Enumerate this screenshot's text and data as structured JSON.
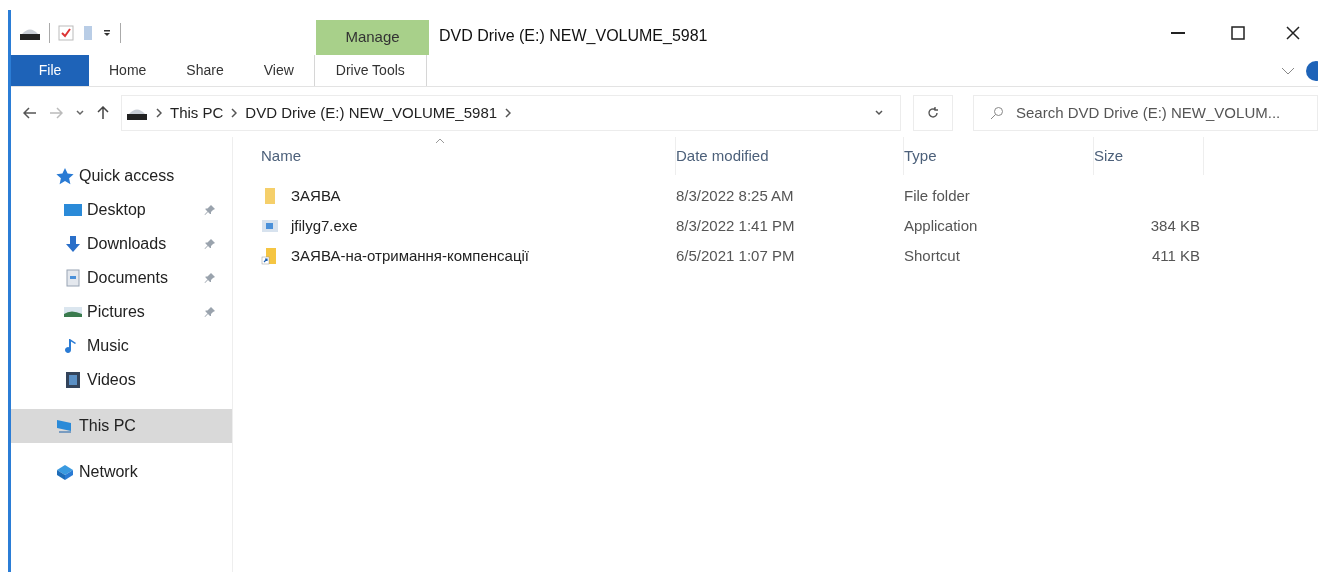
{
  "window": {
    "title": "DVD Drive (E:) NEW_VOLUME_5981"
  },
  "ribbon": {
    "contextual_group": "Manage",
    "tabs": [
      {
        "label": "File",
        "kind": "file",
        "selected": false
      },
      {
        "label": "Home",
        "kind": "normal",
        "selected": false
      },
      {
        "label": "Share",
        "kind": "normal",
        "selected": false
      },
      {
        "label": "View",
        "kind": "normal",
        "selected": false
      },
      {
        "label": "Drive Tools",
        "kind": "contextual",
        "selected": false
      }
    ]
  },
  "address_bar": {
    "breadcrumbs": [
      "This PC",
      "DVD Drive (E:) NEW_VOLUME_5981"
    ]
  },
  "search": {
    "placeholder": "Search DVD Drive (E:) NEW_VOLUM..."
  },
  "sidebar": {
    "items": [
      {
        "label": "Quick access",
        "kind": "star",
        "selected": false,
        "children": [
          {
            "label": "Desktop",
            "kind": "desktop",
            "pinned": true,
            "selected": false
          },
          {
            "label": "Downloads",
            "kind": "downloads",
            "pinned": true,
            "selected": false
          },
          {
            "label": "Documents",
            "kind": "documents",
            "pinned": true,
            "selected": false
          },
          {
            "label": "Pictures",
            "kind": "pictures",
            "pinned": true,
            "selected": false
          },
          {
            "label": "Music",
            "kind": "music",
            "pinned": false,
            "selected": false
          },
          {
            "label": "Videos",
            "kind": "videos",
            "pinned": false,
            "selected": false
          }
        ]
      },
      {
        "label": "This PC",
        "kind": "pc",
        "selected": true
      },
      {
        "label": "Network",
        "kind": "network",
        "selected": false
      }
    ]
  },
  "table": {
    "columns": [
      {
        "label": "Name",
        "sorted": true
      },
      {
        "label": "Date modified",
        "sorted": false
      },
      {
        "label": "Type",
        "sorted": false
      },
      {
        "label": "Size",
        "sorted": false
      }
    ],
    "rows": [
      {
        "kind": "folder",
        "name": "ЗАЯВА",
        "date": "8/3/2022 8:25 AM",
        "type": "File folder"
      },
      {
        "kind": "exe",
        "name": "jfilyg7.exe",
        "date": "8/3/2022 1:41 PM",
        "type": "Application",
        "size": "384 KB"
      },
      {
        "kind": "shortcut",
        "name": "ЗАЯВА-на-отримання-компенсації",
        "date": "6/5/2021 1:07 PM",
        "type": "Shortcut",
        "size": "411 KB"
      }
    ]
  }
}
